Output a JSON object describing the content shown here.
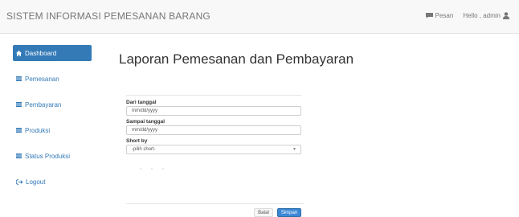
{
  "navbar": {
    "brand": "SISTEM INFORMASI PEMESANAN BARANG",
    "pesan_label": "Pesan",
    "user_label": "Hello , admin"
  },
  "sidebar": {
    "items": [
      {
        "label": "Dashboard",
        "icon": "home-icon",
        "active": true
      },
      {
        "label": "Pemesanan",
        "icon": "table-icon",
        "active": false
      },
      {
        "label": "Pembayaran",
        "icon": "table-icon",
        "active": false
      },
      {
        "label": "Produksi",
        "icon": "table-icon",
        "active": false
      },
      {
        "label": "Status Produksi",
        "icon": "table-icon",
        "active": false
      },
      {
        "label": "Logout",
        "icon": "logout-icon",
        "active": false
      }
    ]
  },
  "main": {
    "title": "Laporan Pemesanan dan Pembayaran",
    "form": {
      "dari_label": "Dari tanggal",
      "dari_value": "mm/dd/yyyy",
      "sampai_label": "Sampai tanggal",
      "sampai_value": "mm/dd/yyyy",
      "short_label": "Short by",
      "short_value": "-pilih short-"
    },
    "buttons": {
      "batal": "Batal",
      "simpan": "Simpan"
    }
  },
  "colors": {
    "primary": "#337ab7",
    "navbar_bg": "#f8f8f8",
    "button_primary": "#3a87d6"
  }
}
